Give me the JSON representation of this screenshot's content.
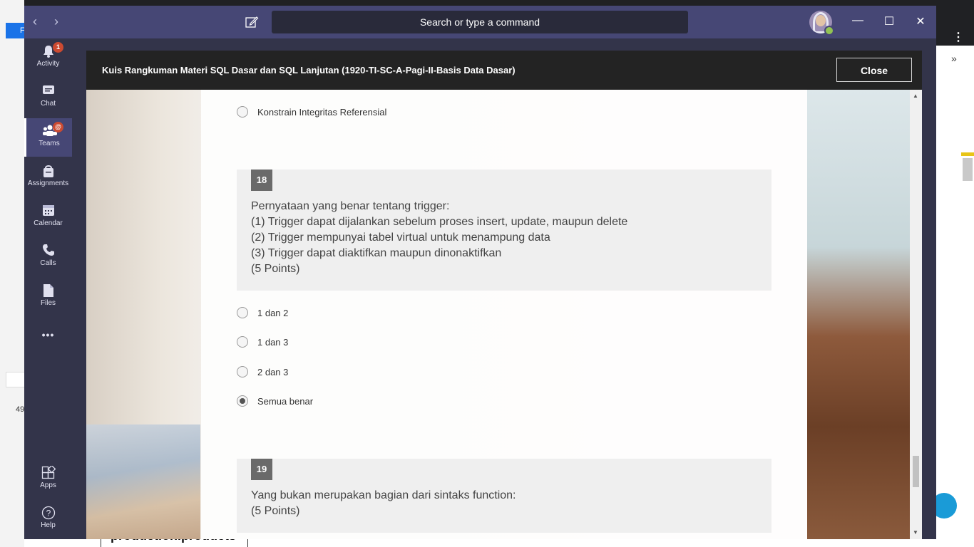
{
  "background": {
    "left_tab_label": "F",
    "left_number": "49",
    "bottom_text": "production.products"
  },
  "titlebar": {
    "search_placeholder": "Search or type a command",
    "back_icon": "chevron-left-icon",
    "forward_icon": "chevron-right-icon",
    "compose_icon": "compose-icon",
    "presence_color": "#92c353"
  },
  "appbar": {
    "items": [
      {
        "label": "Activity",
        "icon": "bell-icon",
        "badge": "1"
      },
      {
        "label": "Chat",
        "icon": "chat-icon"
      },
      {
        "label": "Teams",
        "icon": "teams-icon",
        "badge": "@"
      },
      {
        "label": "Assignments",
        "icon": "assignments-icon"
      },
      {
        "label": "Calendar",
        "icon": "calendar-icon"
      },
      {
        "label": "Calls",
        "icon": "phone-icon"
      },
      {
        "label": "Files",
        "icon": "file-icon"
      },
      {
        "label": "Apps",
        "icon": "apps-icon"
      },
      {
        "label": "Help",
        "icon": "help-icon"
      }
    ],
    "more_label": "•••"
  },
  "modal": {
    "title": "Kuis Rangkuman Materi SQL Dasar dan SQL Lanjutan (1920-TI-SC-A-Pagi-II-Basis Data Dasar)",
    "close_label": "Close"
  },
  "form": {
    "prev_option": "Konstrain Integritas Referensial",
    "q18": {
      "number": "18",
      "lines": [
        "Pernyataan yang benar tentang trigger:",
        "(1) Trigger dapat dijalankan sebelum proses insert, update, maupun delete",
        "(2) Trigger mempunyai tabel virtual untuk menampung data",
        "(3) Trigger dapat diaktifkan maupun dinonaktifkan",
        "(5 Points)"
      ],
      "options": [
        "1 dan 2",
        "1 dan 3",
        "2 dan 3",
        "Semua benar"
      ],
      "selected": "Semua benar"
    },
    "q19": {
      "number": "19",
      "lines": [
        "Yang bukan merupakan bagian dari sintaks function:",
        "(5 Points)"
      ]
    }
  }
}
